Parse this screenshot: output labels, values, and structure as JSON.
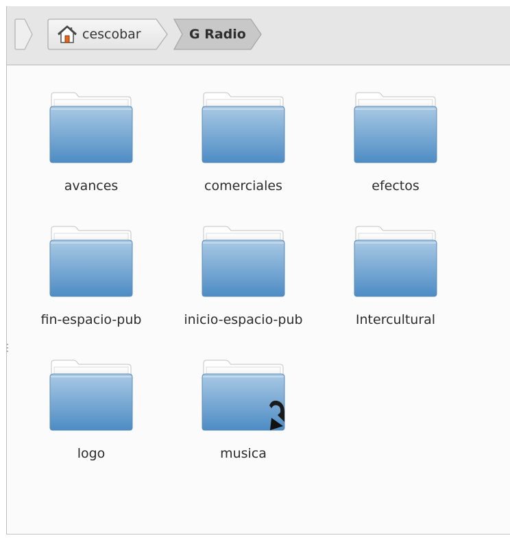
{
  "pathbar": {
    "back_arrow": "chevron-left-icon",
    "home_icon": "home-icon",
    "home_label": "cescobar",
    "current_label": "G Radio"
  },
  "folders": [
    {
      "name": "avances",
      "icon": "folder-icon",
      "symlink": false
    },
    {
      "name": "comerciales",
      "icon": "folder-icon",
      "symlink": false
    },
    {
      "name": "efectos",
      "icon": "folder-icon",
      "symlink": false
    },
    {
      "name": "fin-espacio-pub",
      "icon": "folder-icon",
      "symlink": false
    },
    {
      "name": "inicio-espacio-pub",
      "icon": "folder-icon",
      "symlink": false
    },
    {
      "name": "Intercultural",
      "icon": "folder-icon",
      "symlink": false
    },
    {
      "name": "logo",
      "icon": "folder-icon",
      "symlink": false
    },
    {
      "name": "musica",
      "icon": "folder-icon",
      "symlink": true
    }
  ],
  "colors": {
    "folder_top": "#a9c9e4",
    "folder_bottom": "#4d8cc4",
    "current_crumb": "#c9c9c9"
  }
}
